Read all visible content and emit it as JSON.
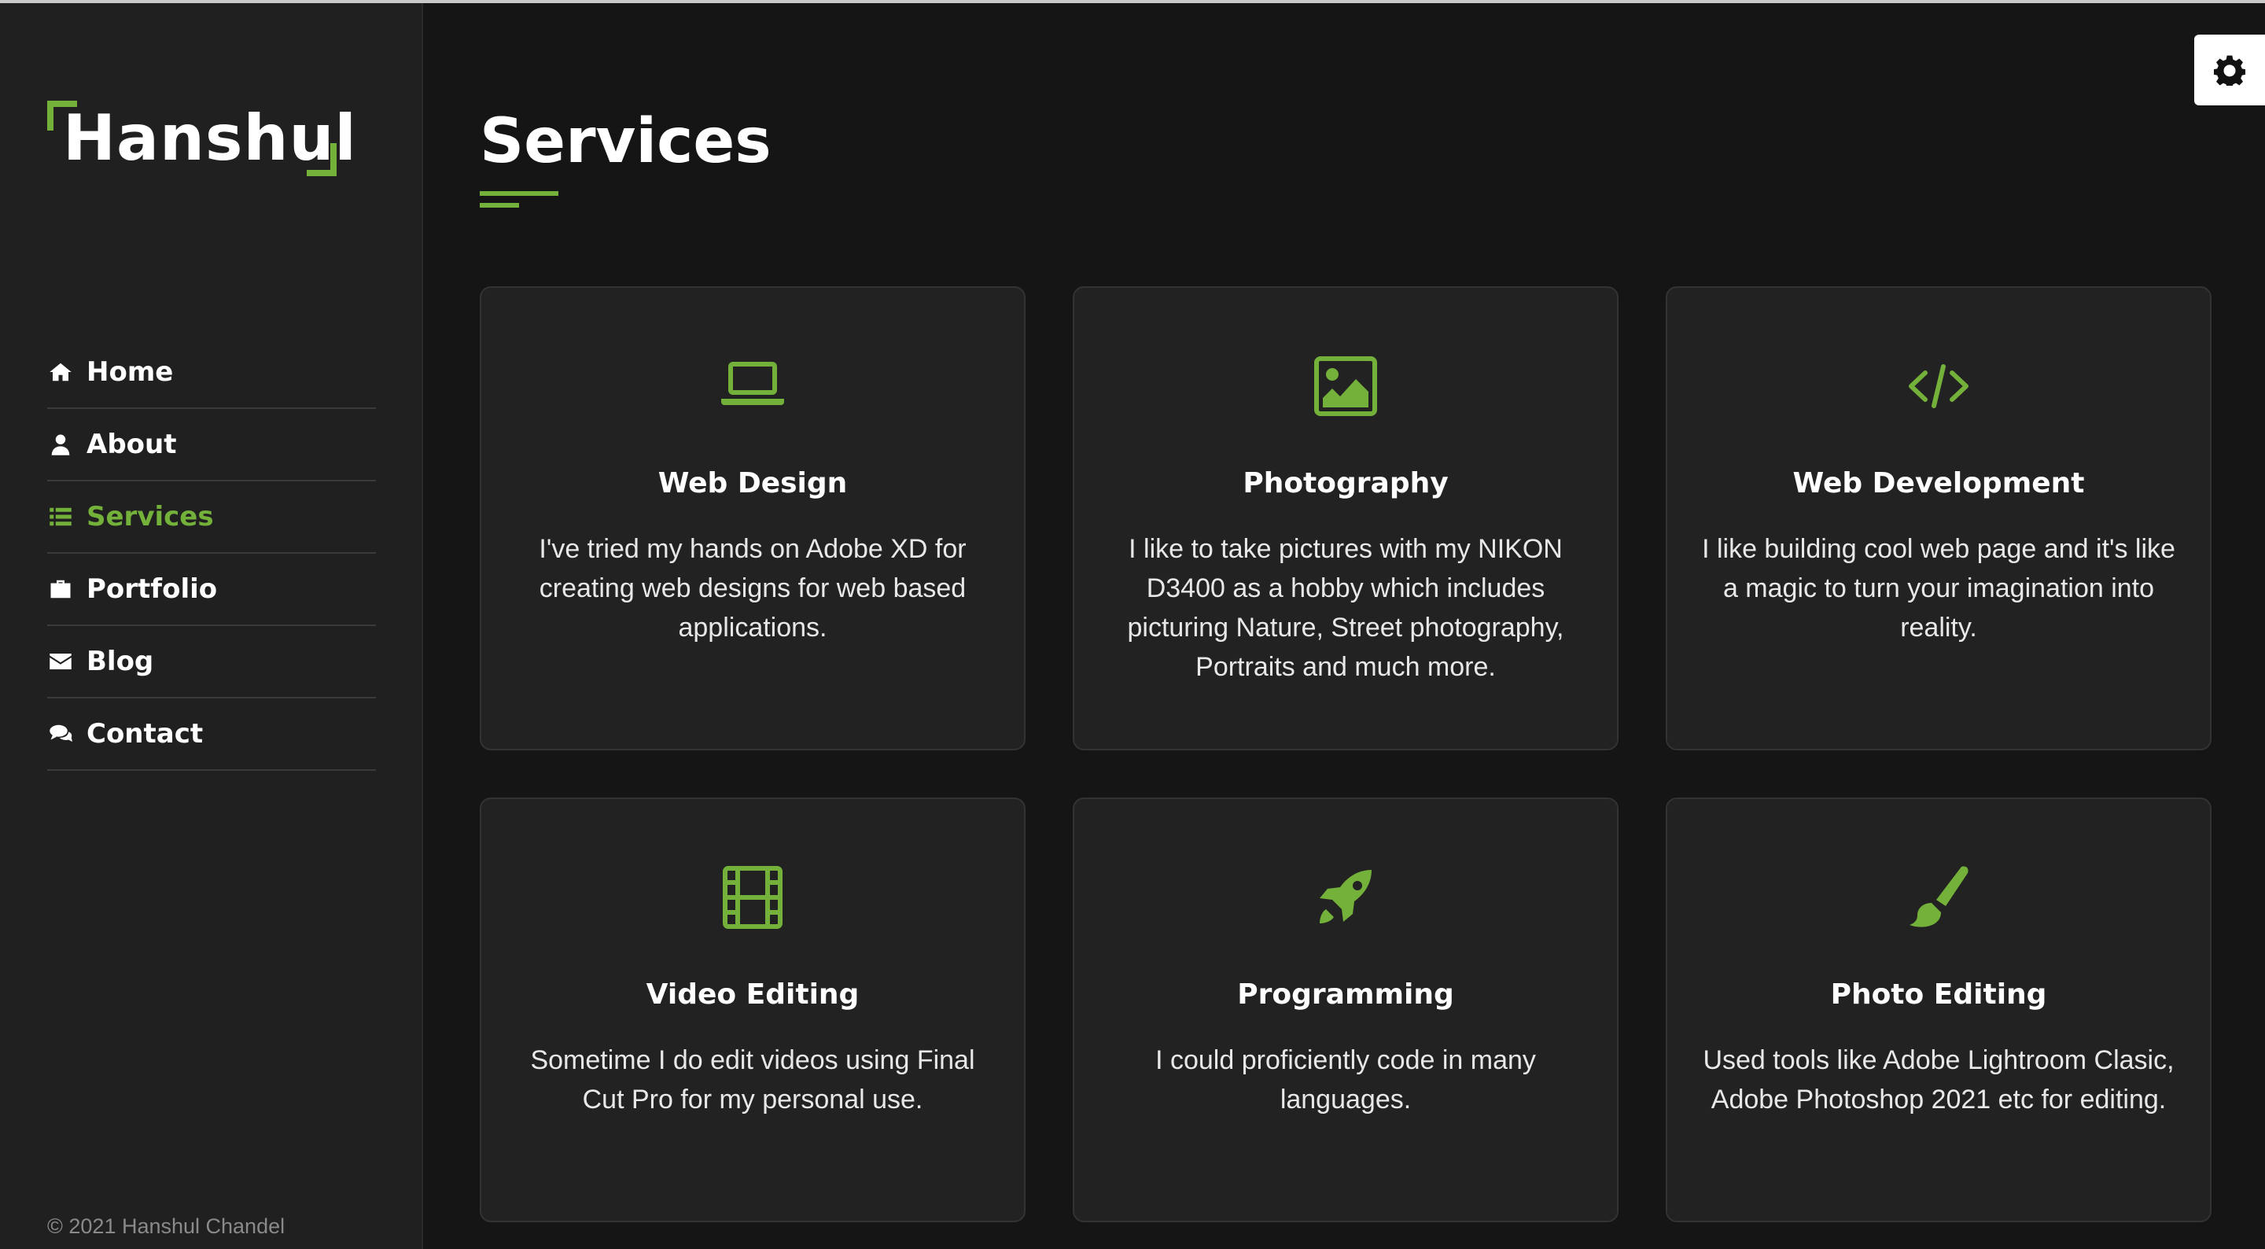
{
  "sidebar": {
    "logo_text": "Hanshul",
    "nav": [
      {
        "label": "Home",
        "icon": "home-icon"
      },
      {
        "label": "About",
        "icon": "user-icon"
      },
      {
        "label": "Services",
        "icon": "list-icon",
        "active": true
      },
      {
        "label": "Portfolio",
        "icon": "briefcase-icon"
      },
      {
        "label": "Blog",
        "icon": "envelope-icon"
      },
      {
        "label": "Contact",
        "icon": "comments-icon"
      }
    ],
    "copyright": "© 2021 Hanshul Chandel"
  },
  "main": {
    "title": "Services",
    "services": [
      {
        "title": "Web Design",
        "icon": "laptop-icon",
        "description": "I've tried my hands on Adobe XD for creating web designs for web based applications."
      },
      {
        "title": "Photography",
        "icon": "image-icon",
        "description": "I like to take pictures with my NIKON D3400 as a hobby which includes picturing Nature, Street photography, Portraits and much more."
      },
      {
        "title": "Web Development",
        "icon": "code-icon",
        "description": "I like building cool web page and it's like a magic to turn your imagination into reality."
      },
      {
        "title": "Video Editing",
        "icon": "film-icon",
        "description": "Sometime I do edit videos using Final Cut Pro for my personal use."
      },
      {
        "title": "Programming",
        "icon": "rocket-icon",
        "description": "I could proficiently code in many languages."
      },
      {
        "title": "Photo Editing",
        "icon": "paint-brush-icon",
        "description": "Used tools like Adobe Lightroom Clasic, Adobe Photoshop 2021 etc for editing."
      }
    ]
  },
  "settings": {
    "icon": "gear-icon"
  },
  "colors": {
    "accent": "#74b13a",
    "sidebar_bg": "#202020",
    "main_bg": "#151515",
    "card_bg": "#222222"
  }
}
